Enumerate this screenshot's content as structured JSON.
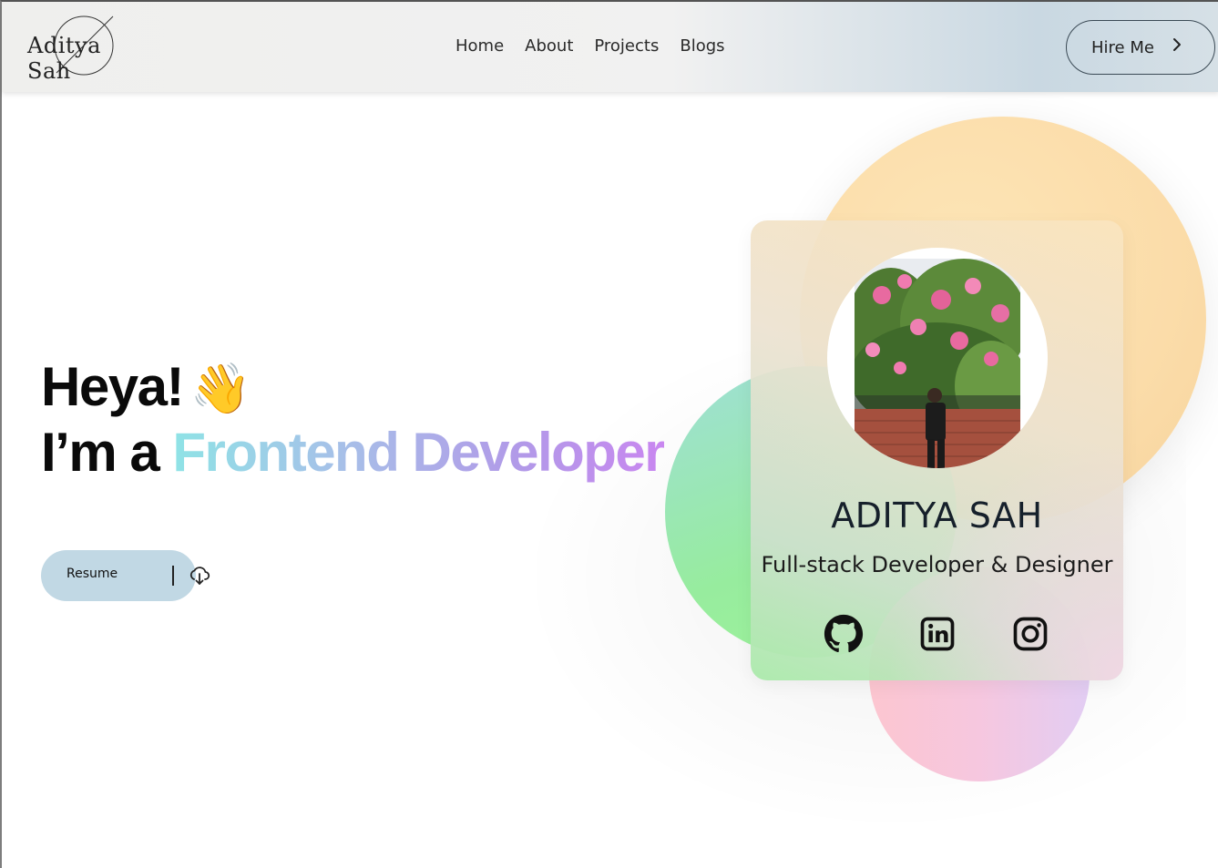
{
  "brand": {
    "logo_text": "Aditya Sah"
  },
  "nav": {
    "links": [
      "Home",
      "About",
      "Projects",
      "Blogs"
    ],
    "hire_label": "Hire Me",
    "hire_icon": "chevron-right-icon"
  },
  "hero": {
    "line1": "Heya!",
    "wave_emoji": "👋",
    "line2_prefix": "I’m a",
    "line2_highlight": "Frontend Developer",
    "resume_label": "Resume",
    "resume_icon": "cloud-download-icon"
  },
  "card": {
    "name": "ADITYA SAH",
    "role": "Full-stack Developer & Designer",
    "socials": [
      "github-icon",
      "linkedin-icon",
      "instagram-icon"
    ]
  },
  "colors": {
    "nav_accent": "#c9d8e2",
    "resume_bg": "#c1d8e4",
    "gradient_start": "#8fe3e6",
    "gradient_end": "#c987f0",
    "blob_orange": "#fbdca9",
    "blob_green": "#97ec9e",
    "blob_pink": "#fcc6d0"
  }
}
